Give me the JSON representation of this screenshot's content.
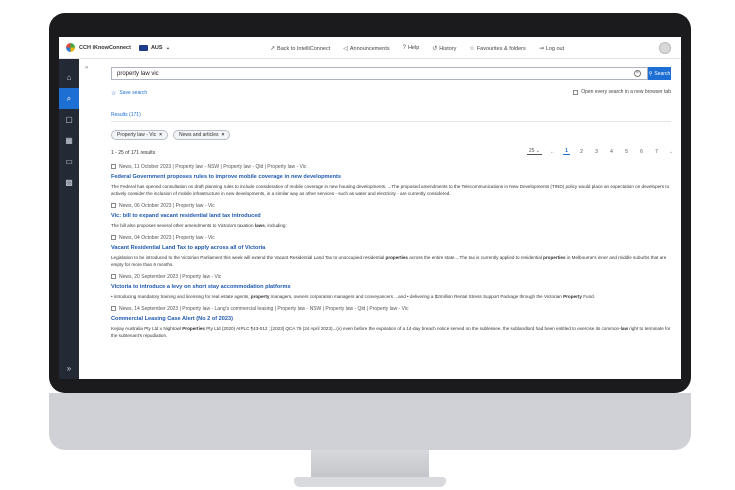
{
  "header": {
    "brand": "CCH iKnowConnect",
    "region": "AUS",
    "nav": [
      {
        "label": "Back to IntelliConnect",
        "glyph": "↗"
      },
      {
        "label": "Announcements",
        "glyph": "◁"
      },
      {
        "label": "Help",
        "glyph": "?"
      },
      {
        "label": "History",
        "glyph": "↺"
      },
      {
        "label": "Favourites & folders",
        "glyph": "☆"
      },
      {
        "label": "Log out",
        "glyph": "⇥"
      }
    ]
  },
  "sidebar": {
    "items": [
      {
        "icon": "home-icon",
        "glyph": "⌂"
      },
      {
        "icon": "search-icon",
        "glyph": "⌕"
      },
      {
        "icon": "briefcase-icon",
        "glyph": "▢"
      },
      {
        "icon": "calculator-icon",
        "glyph": "▦"
      },
      {
        "icon": "book-icon",
        "glyph": "▭"
      },
      {
        "icon": "grid-icon",
        "glyph": "▩"
      }
    ],
    "expand_glyph": "»",
    "collapse_glyph": "»"
  },
  "search": {
    "query": "property law vic",
    "clear_glyph": "×",
    "button_label": "Search",
    "save_label": "Save search",
    "new_tab_label": "Open every search in a new browser tab"
  },
  "results_tab": "Results (171)",
  "filters": [
    {
      "label": "Property law - Vic"
    },
    {
      "label": "News and articles"
    }
  ],
  "count_text": "1 - 25 of 171 results",
  "pagination": {
    "per_page": "25",
    "pages": [
      "1",
      "2",
      "3",
      "4",
      "5",
      "6",
      "7"
    ],
    "current": "1",
    "prev": "←",
    "next": "→"
  },
  "results": [
    {
      "meta": "News, 11 October 2023 | Property law - NSW | Property law - Qld | Property law - Vic",
      "title": "Federal Government proposes rules to improve mobile coverage in new developments",
      "snippet": [
        {
          "text": "The Federal has opened consultation on draft planning rules to include consideration of mobile coverage in new housing developments. ...The proposed amendments to the Telecommunications in New Developments (TIND) policy would place an expectation on developers to actively consider the inclusion of mobile infrastructure in new developments, in a similar way as other services - such as water and electricity - are currently considered.",
          "bold": false
        }
      ]
    },
    {
      "meta": "News, 06 October 2023 | Property law - Vic",
      "title": "Vic: bill to expand vacant residential land tax introduced",
      "snippet": [
        {
          "text": "The bill also proposes several other amendments to Victoria's taxation ",
          "bold": false
        },
        {
          "text": "laws",
          "bold": true
        },
        {
          "text": ", including:",
          "bold": false
        }
      ]
    },
    {
      "meta": "News, 04 October 2023 | Property law - Vic",
      "title": "Vacant Residential Land Tax to apply across all of Victoria",
      "snippet": [
        {
          "text": "Legislation to be introduced to the Victorian Parliament this week will extend the Vacant Residential Land Tax to unoccupied residential ",
          "bold": false
        },
        {
          "text": "properties",
          "bold": true
        },
        {
          "text": " across the entire state....The tax is currently applied to  residential ",
          "bold": false
        },
        {
          "text": "properties",
          "bold": true
        },
        {
          "text": " in Melbourne's inner and middle suburbs that are empty for more than 6 months.",
          "bold": false
        }
      ]
    },
    {
      "meta": "News, 20 September 2023 | Property law - Vic",
      "title": "Victoria to introduce a levy on short stay accommodation platforms",
      "snippet": [
        {
          "text": "•  introducing mandatory training and licensing for real estate agents, ",
          "bold": false
        },
        {
          "text": "property",
          "bold": true
        },
        {
          "text": " managers, owners corporation managers and conveyancers ...and  •  delivering a $2million Rental Stress Support Package through the Victorian ",
          "bold": false
        },
        {
          "text": "Property",
          "bold": true
        },
        {
          "text": " Fund.",
          "bold": false
        }
      ]
    },
    {
      "meta": "News, 14 September 2023 | Property law - Lang's commercial leasing | Property law - NSW | Property law - Qld | Property law - Vic",
      "title": "Commercial Leasing Case Alert (No 2 of 2023)",
      "snippet": [
        {
          "text": "Kejray Australia Pty Ltd v Nightowl ",
          "bold": false
        },
        {
          "text": "Properties",
          "bold": true
        },
        {
          "text": " Pty Ltd (2020) AIPLC ¶43-012 ; [2023] QCA 79 (24 April 2023)...(v) even before the expiration of a 14-day breach notice served on the sublessee, the sublandlord had been entitled to exercise its common-",
          "bold": false
        },
        {
          "text": "law",
          "bold": true
        },
        {
          "text": " right to terminate for the subtenant's repudiation.",
          "bold": false
        }
      ]
    }
  ]
}
